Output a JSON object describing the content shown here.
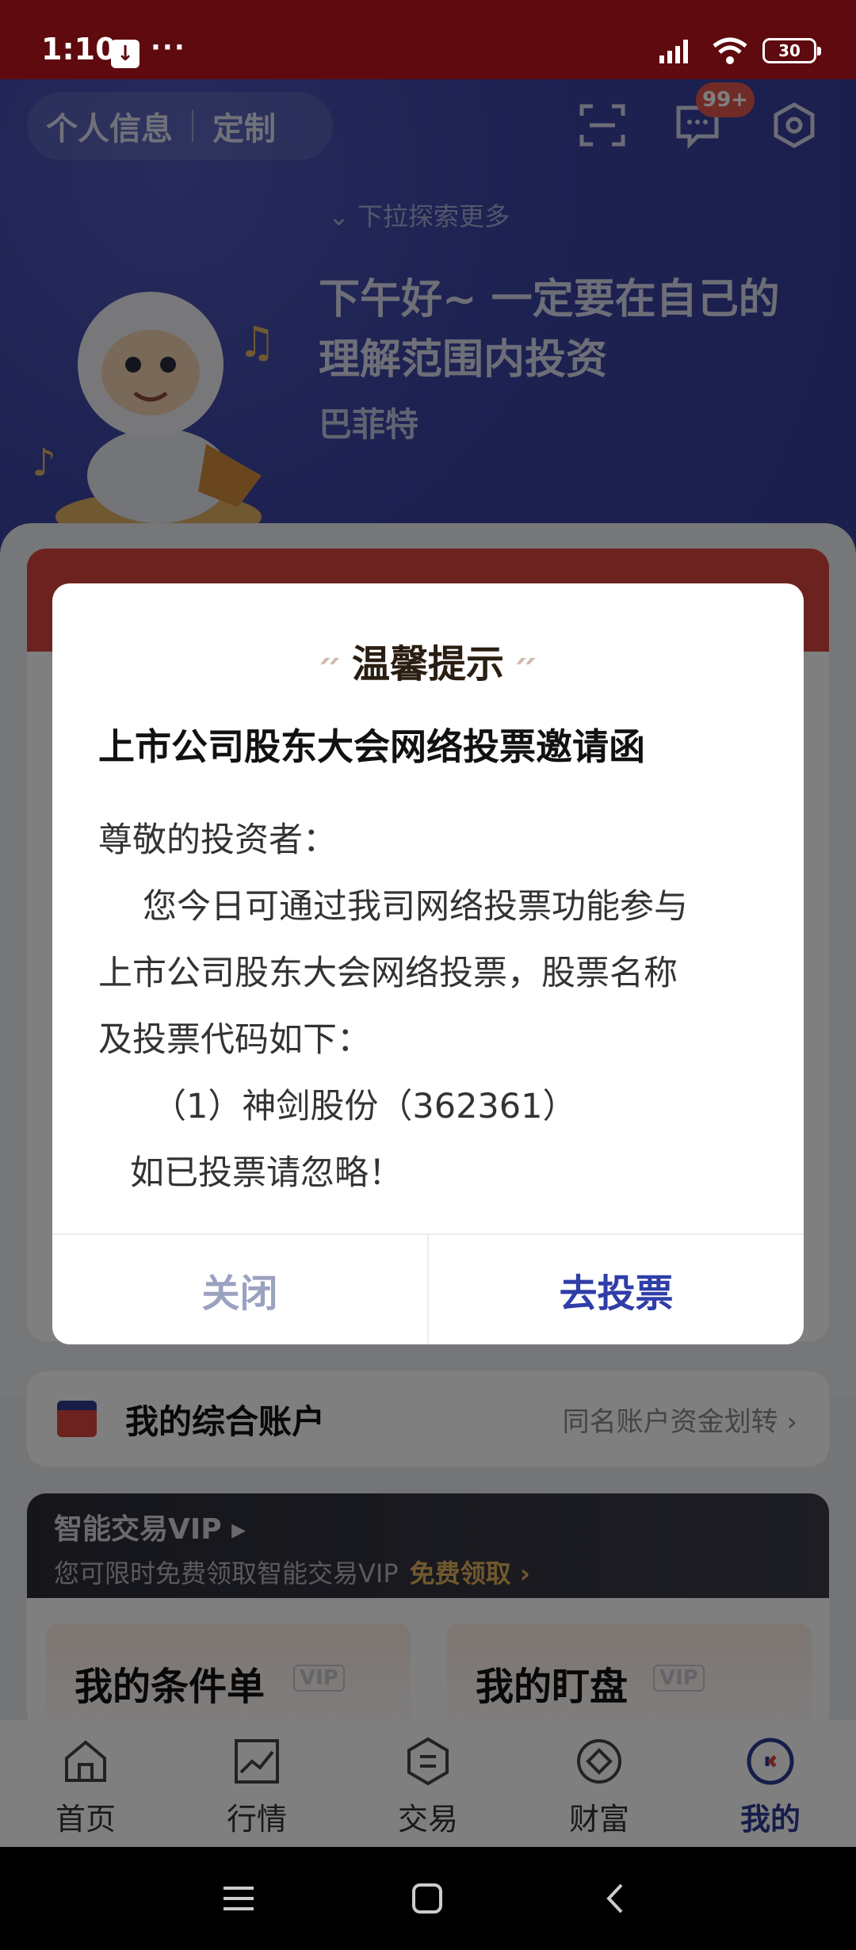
{
  "status_bar": {
    "time": "1:10",
    "download_icon": "download-icon",
    "more": "···",
    "battery": "30"
  },
  "header": {
    "personal_info": "个人信息",
    "customize": "定制",
    "message_badge": "99+",
    "pull_hint": "下拉探索更多",
    "greeting": "下午好~ 一定要在自己的理解范围内投资",
    "author": "巴菲特"
  },
  "account": {
    "title": "我的综合账户",
    "link": "同名账户资金划转 ›"
  },
  "vip": {
    "title": "智能交易VIP ▸",
    "subtitle": "您可限时免费领取智能交易VIP",
    "cta": "免费领取 ›",
    "tile1": "我的条件单",
    "tile2": "我的盯盘",
    "vip_mark": "VIP"
  },
  "nav": {
    "items": [
      {
        "label": "首页"
      },
      {
        "label": "行情"
      },
      {
        "label": "交易"
      },
      {
        "label": "财富"
      },
      {
        "label": "我的"
      }
    ]
  },
  "dialog": {
    "title": "温馨提示",
    "heading": "上市公司股东大会网络投票邀请函",
    "salutation": "尊敬的投资者：",
    "body1": "您今日可通过我司网络投票功能参与",
    "body2": "上市公司股东大会网络投票，股票名称",
    "body3": "及投票代码如下：",
    "item1": "（1）神剑股份（362361）",
    "note": "如已投票请忽略！",
    "close_label": "关闭",
    "vote_label": "去投票"
  },
  "colors": {
    "status_bar": "#5e0a0e",
    "hero": "#3a44a3",
    "accent": "#2f3ea8",
    "red": "#d8473f"
  }
}
